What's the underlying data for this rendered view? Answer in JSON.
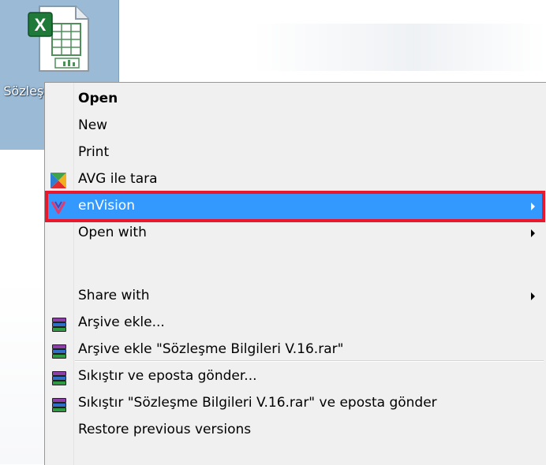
{
  "desktop": {
    "file": {
      "label": "Sözleşme Bilgileri V.16",
      "icon": "excel-file-icon"
    }
  },
  "context_menu": {
    "items": [
      {
        "label": "Open",
        "bold": true
      },
      {
        "label": "New"
      },
      {
        "label": "Print"
      },
      {
        "label": "AVG ile tara",
        "icon": "avg-icon"
      },
      {
        "label": "enVision",
        "icon": "envision-icon",
        "submenu": true,
        "highlighted": true
      },
      {
        "label": "Open with",
        "submenu": true
      },
      {
        "label": "Share with",
        "submenu": true
      },
      {
        "label": "Arşive ekle...",
        "icon": "winrar-icon"
      },
      {
        "label": "Arşive ekle \"Sözleşme Bilgileri V.16.rar\"",
        "icon": "winrar-icon"
      },
      {
        "label": "Sıkıştır ve eposta gönder...",
        "icon": "winrar-icon"
      },
      {
        "label": "Sıkıştır \"Sözleşme Bilgileri V.16.rar\" ve eposta gönder",
        "icon": "winrar-icon"
      },
      {
        "label": "Restore previous versions"
      }
    ]
  },
  "colors": {
    "highlight": "#3399ff",
    "highlight_outline": "#e8192c",
    "menu_background": "#f0f0f0",
    "selection_background": "#9bbad6"
  }
}
